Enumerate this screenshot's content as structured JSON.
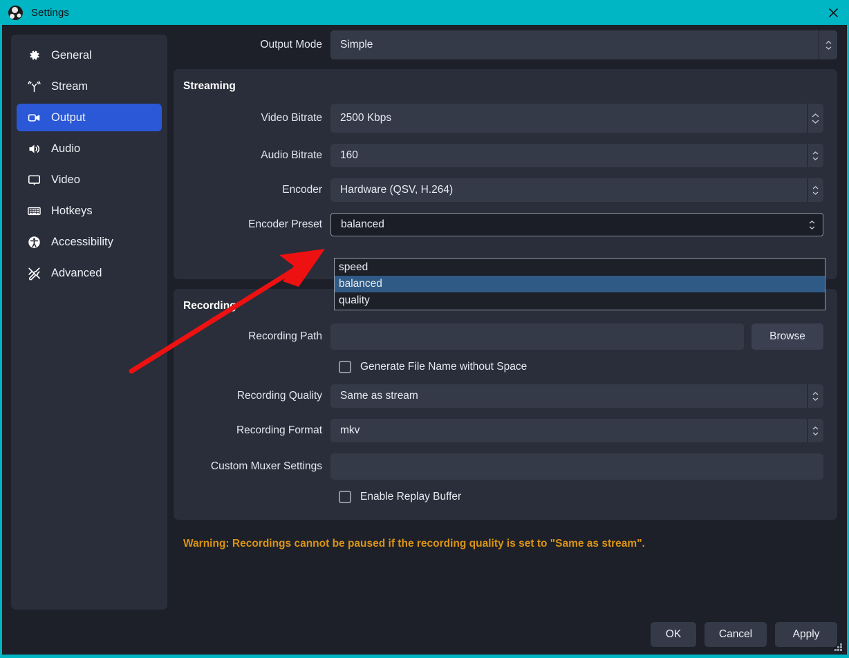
{
  "window": {
    "title": "Settings",
    "logo_icon": "obs-logo-icon",
    "close_icon": "close-icon",
    "accent_color": "#00b5c4"
  },
  "sidebar": {
    "items": [
      {
        "label": "General",
        "icon": "gear-icon",
        "active": false
      },
      {
        "label": "Stream",
        "icon": "broadcast-icon",
        "active": false
      },
      {
        "label": "Output",
        "icon": "output-screen-icon",
        "active": true
      },
      {
        "label": "Audio",
        "icon": "speaker-icon",
        "active": false
      },
      {
        "label": "Video",
        "icon": "monitor-icon",
        "active": false
      },
      {
        "label": "Hotkeys",
        "icon": "keyboard-icon",
        "active": false
      },
      {
        "label": "Accessibility",
        "icon": "accessibility-icon",
        "active": false
      },
      {
        "label": "Advanced",
        "icon": "tools-icon",
        "active": false
      }
    ],
    "active_color": "#2b58d6"
  },
  "output_mode": {
    "label": "Output Mode",
    "value": "Simple"
  },
  "streaming": {
    "title": "Streaming",
    "video_bitrate": {
      "label": "Video Bitrate",
      "value": "2500 Kbps"
    },
    "audio_bitrate": {
      "label": "Audio Bitrate",
      "value": "160"
    },
    "encoder": {
      "label": "Encoder",
      "value": "Hardware (QSV, H.264)"
    },
    "encoder_preset": {
      "label": "Encoder Preset",
      "value": "balanced",
      "open": true,
      "options": [
        "speed",
        "balanced",
        "quality"
      ],
      "selected": "balanced",
      "highlight_color": "#2f5a85"
    }
  },
  "recording": {
    "title": "Recording",
    "recording_path": {
      "label": "Recording Path",
      "value": "",
      "placeholder": ""
    },
    "browse_label": "Browse",
    "generate_filename": {
      "label": "Generate File Name without Space",
      "checked": false
    },
    "recording_quality": {
      "label": "Recording Quality",
      "value": "Same as stream"
    },
    "recording_format": {
      "label": "Recording Format",
      "value": "mkv"
    },
    "custom_muxer": {
      "label": "Custom Muxer Settings",
      "value": "",
      "placeholder": ""
    },
    "replay_buffer": {
      "label": "Enable Replay Buffer",
      "checked": false
    }
  },
  "warning": {
    "text": "Warning: Recordings cannot be paused if the recording quality is set to \"Same as stream\".",
    "color": "#d99317"
  },
  "footer": {
    "ok": "OK",
    "cancel": "Cancel",
    "apply": "Apply"
  },
  "annotation": {
    "arrow_color": "#ee1111",
    "points_to": "encoder-preset-dropdown"
  }
}
